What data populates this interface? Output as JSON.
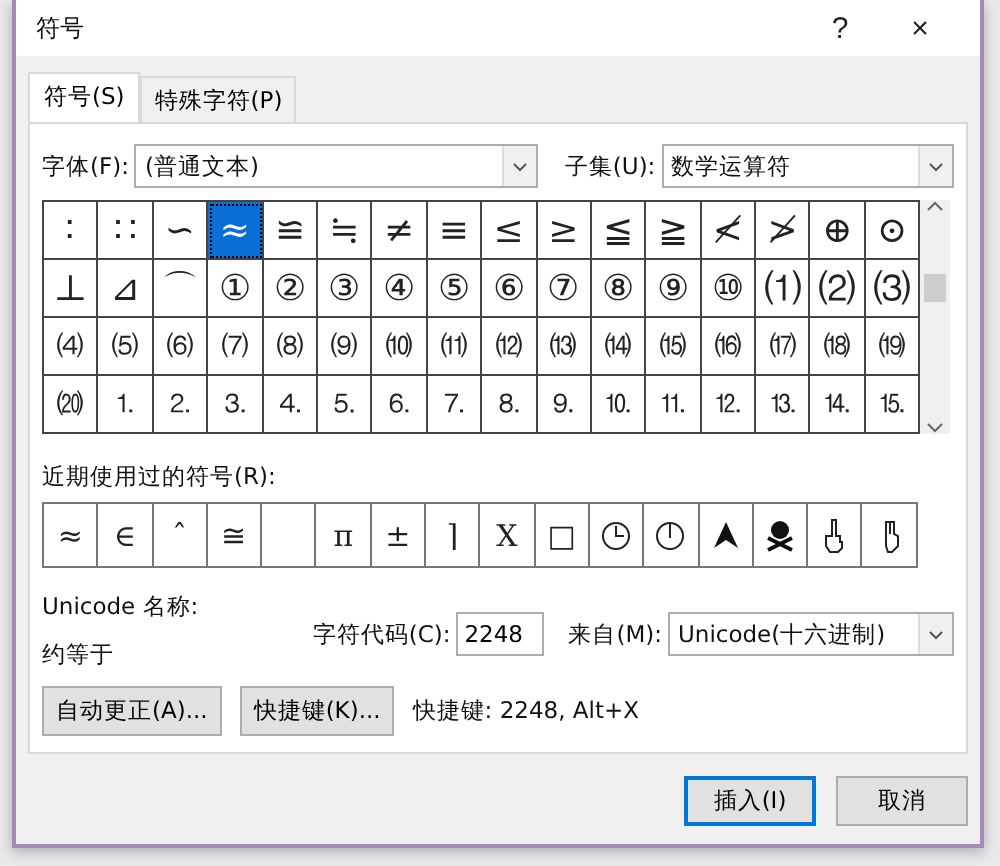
{
  "window": {
    "title": "符号",
    "help": "?",
    "close": "×"
  },
  "tabs": [
    {
      "label": "符号(S)",
      "selected": true
    },
    {
      "label": "特殊字符(P)",
      "selected": false
    }
  ],
  "font": {
    "label": "字体(F):",
    "value": "(普通文本)"
  },
  "subset": {
    "label": "子集(U):",
    "value": "数学运算符"
  },
  "grid": [
    [
      {
        "char": "∶",
        "selected": false
      },
      {
        "char": "∷",
        "selected": false
      },
      {
        "char": "∽",
        "selected": false
      },
      {
        "char": "≈",
        "selected": true
      },
      {
        "char": "≌",
        "selected": false
      },
      {
        "char": "≒",
        "selected": false
      },
      {
        "char": "≠",
        "selected": false
      },
      {
        "char": "≡",
        "selected": false
      },
      {
        "char": "≤",
        "selected": false
      },
      {
        "char": "≥",
        "selected": false
      },
      {
        "char": "≦",
        "selected": false
      },
      {
        "char": "≧",
        "selected": false
      },
      {
        "char": "≮",
        "selected": false
      },
      {
        "char": "≯",
        "selected": false
      },
      {
        "char": "⊕",
        "selected": false
      },
      {
        "char": "⊙",
        "selected": false
      }
    ],
    [
      {
        "char": "⊥",
        "selected": false
      },
      {
        "char": "⊿",
        "selected": false
      },
      {
        "char": "⌒",
        "selected": false
      },
      {
        "char": "①",
        "selected": false
      },
      {
        "char": "②",
        "selected": false
      },
      {
        "char": "③",
        "selected": false
      },
      {
        "char": "④",
        "selected": false
      },
      {
        "char": "⑤",
        "selected": false
      },
      {
        "char": "⑥",
        "selected": false
      },
      {
        "char": "⑦",
        "selected": false
      },
      {
        "char": "⑧",
        "selected": false
      },
      {
        "char": "⑨",
        "selected": false
      },
      {
        "char": "⑩",
        "selected": false
      },
      {
        "char": "⑴",
        "selected": false
      },
      {
        "char": "⑵",
        "selected": false
      },
      {
        "char": "⑶",
        "selected": false
      }
    ],
    [
      {
        "char": "⑷",
        "selected": false
      },
      {
        "char": "⑸",
        "selected": false
      },
      {
        "char": "⑹",
        "selected": false
      },
      {
        "char": "⑺",
        "selected": false
      },
      {
        "char": "⑻",
        "selected": false
      },
      {
        "char": "⑼",
        "selected": false
      },
      {
        "char": "⑽",
        "selected": false
      },
      {
        "char": "⑾",
        "selected": false
      },
      {
        "char": "⑿",
        "selected": false
      },
      {
        "char": "⒀",
        "selected": false
      },
      {
        "char": "⒁",
        "selected": false
      },
      {
        "char": "⒂",
        "selected": false
      },
      {
        "char": "⒃",
        "selected": false
      },
      {
        "char": "⒄",
        "selected": false
      },
      {
        "char": "⒅",
        "selected": false
      },
      {
        "char": "⒆",
        "selected": false
      }
    ],
    [
      {
        "char": "⒇",
        "selected": false
      },
      {
        "char": "⒈",
        "selected": false
      },
      {
        "char": "⒉",
        "selected": false
      },
      {
        "char": "⒊",
        "selected": false
      },
      {
        "char": "⒋",
        "selected": false
      },
      {
        "char": "⒌",
        "selected": false
      },
      {
        "char": "⒍",
        "selected": false
      },
      {
        "char": "⒎",
        "selected": false
      },
      {
        "char": "⒏",
        "selected": false
      },
      {
        "char": "⒐",
        "selected": false
      },
      {
        "char": "⒑",
        "selected": false
      },
      {
        "char": "⒒",
        "selected": false
      },
      {
        "char": "⒓",
        "selected": false
      },
      {
        "char": "⒔",
        "selected": false
      },
      {
        "char": "⒕",
        "selected": false
      },
      {
        "char": "⒖",
        "selected": false
      }
    ]
  ],
  "recent": {
    "label": "近期使用过的符号(R):",
    "items": [
      {
        "kind": "char",
        "char": "≈"
      },
      {
        "kind": "char",
        "char": "∈"
      },
      {
        "kind": "char",
        "char": "ˆ"
      },
      {
        "kind": "char",
        "char": "≅"
      },
      {
        "kind": "empty"
      },
      {
        "kind": "char",
        "char": "π"
      },
      {
        "kind": "char",
        "char": "±"
      },
      {
        "kind": "char",
        "char": "⌉"
      },
      {
        "kind": "char",
        "char": "X"
      },
      {
        "kind": "char",
        "char": "□"
      },
      {
        "kind": "clock"
      },
      {
        "kind": "clock-twelve"
      },
      {
        "kind": "arrowhead"
      },
      {
        "kind": "skull"
      },
      {
        "kind": "hand-up"
      },
      {
        "kind": "hand-point"
      }
    ]
  },
  "unicode_name": {
    "label": "Unicode 名称:",
    "value": "约等于"
  },
  "char_code": {
    "label": "字符代码(C):",
    "value": "2248"
  },
  "from": {
    "label": "来自(M):",
    "value": "Unicode(十六进制)"
  },
  "buttons": [
    {
      "label": "自动更正(A)..."
    },
    {
      "label": "快捷键(K)..."
    }
  ],
  "shortcut": "快捷键: 2248, Alt+X",
  "footer": [
    {
      "label": "插入(I)",
      "default": true
    },
    {
      "label": "取消",
      "default": false
    }
  ]
}
